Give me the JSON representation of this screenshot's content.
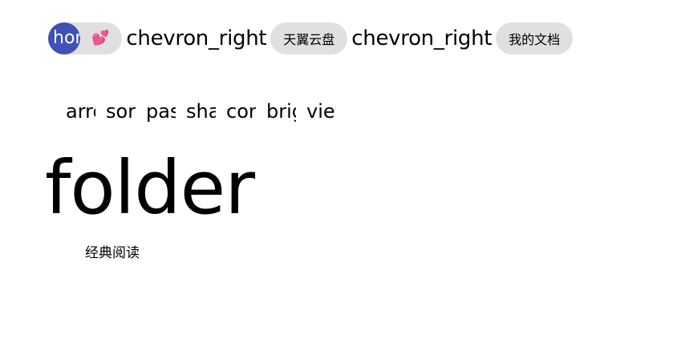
{
  "breadcrumb": {
    "home_icon_text": "home",
    "home_badge_icon": "💕",
    "separator_text": "chevron_right",
    "items": [
      {
        "label": "天翼云盘"
      },
      {
        "label": "我的文档"
      }
    ]
  },
  "toolbar": {
    "buttons": [
      {
        "icon": "arrow_upward"
      },
      {
        "icon": "sort"
      },
      {
        "icon": "paste"
      },
      {
        "icon": "share"
      },
      {
        "icon": "content_copy"
      },
      {
        "icon": "brightness"
      },
      {
        "icon": "view"
      }
    ]
  },
  "folders": [
    {
      "icon": "folder",
      "name": "经典阅读"
    }
  ],
  "colors": {
    "chip_bg": "#e0e0e0",
    "avatar_bg": "#3f51b5",
    "heart": "#e91e63"
  }
}
